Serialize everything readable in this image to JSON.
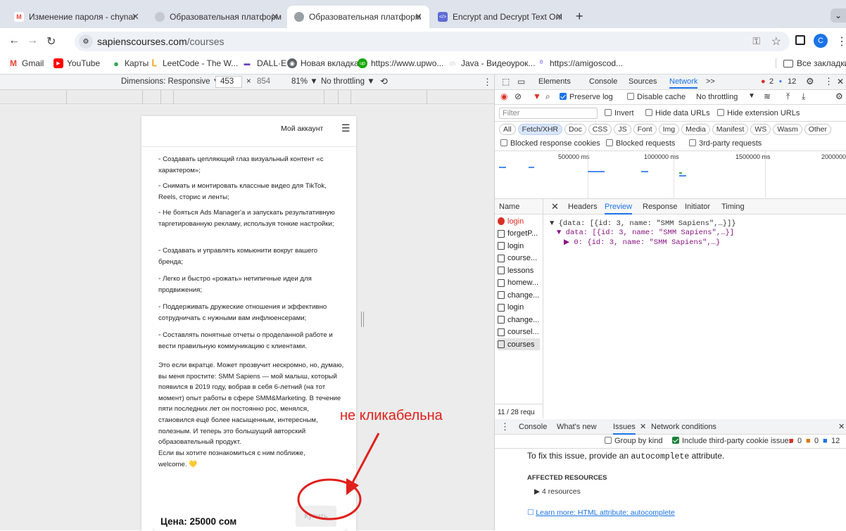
{
  "browser": {
    "tabs": [
      {
        "title": "Изменение пароля - chynar",
        "favicon": "gmail-icon",
        "favicon_color": "#EA4335"
      },
      {
        "title": "Образовательная платформ",
        "favicon": "globe-icon",
        "favicon_color": "#9aa0a6"
      },
      {
        "title": "Образовательная платформ",
        "favicon": "globe-icon",
        "favicon_color": "#9aa0a6",
        "active": true
      },
      {
        "title": "Encrypt and Decrypt Text Onl",
        "favicon": "lock-icon",
        "favicon_color": "#5f6bd6"
      }
    ],
    "new_tab": "+",
    "url_host": "sapienscourses.com",
    "url_path": "/courses",
    "profile_initial": "C",
    "bookmarks": [
      {
        "label": "Gmail",
        "icon": "gmail-icon",
        "color": "#EA4335"
      },
      {
        "label": "YouTube",
        "icon": "youtube-icon",
        "color": "#FF0000"
      },
      {
        "label": "Карты",
        "icon": "maps-icon",
        "color": "#34A853"
      },
      {
        "label": "LeetCode - The W...",
        "icon": "leetcode-icon",
        "color": "#FFA116"
      },
      {
        "label": "DALL·E",
        "icon": "dalle-icon",
        "color": "#6f42c1"
      },
      {
        "label": "Новая вкладка",
        "icon": "chrome-icon",
        "color": "#5f6368"
      },
      {
        "label": "https://www.upwo...",
        "icon": "upwork-icon",
        "color": "#14a800"
      },
      {
        "label": "Java - Видеоурок...",
        "icon": "java-icon",
        "color": "#b0b0b0"
      },
      {
        "label": "https://amigoscod...",
        "icon": "amigos-icon",
        "color": "#7b61ff"
      }
    ],
    "all_bookmarks": "Все закладки"
  },
  "device_toolbar": {
    "dimensions": "Dimensions: Responsive ▼",
    "width": "453",
    "times": "×",
    "height": "854",
    "zoom": "81% ▼",
    "throttling": "No throttling ▼"
  },
  "page": {
    "account_button": "Мой аккаунт",
    "bullets": [
      "◦ Создавать цепляющий глаз визуальный контент «с характером»;",
      "◦ Снимать и монтировать классные видео для TikTok, Reels, сторис и ленты;",
      "◦ Не бояться Ads Manager'а и запускать результативную таргетированную рекламу, используя тонкие настройки;",
      "◦ Создавать и управлять комьюнити вокруг вашего бренда;",
      "◦ Легко и быстро «рожать» нетипичные идеи для продвижения;",
      "◦ Поддерживать дружеские отношения и эффективно сотрудничать с нужными вам инфлюенсерами;",
      "◦ Составлять понятные отчеты о проделанной работе и вести правильную коммуникацию с клиентами."
    ],
    "paragraph1": "Это если вкратце. Может прозвучит нескромно, но, думаю, вы меня простите: SMM Sapiens — мой малыш, который появился в 2019 году, вобрав в себя 6-летний (на тот момент) опыт работы в сфере SMM&Marketing. В течение пяти последних лет он постоянно рос, менялся, становился ещё более насыщенным, интересным, полезным. И теперь это большущий авторский образовательный продукт.",
    "paragraph2": "Если вы хотите познакомиться с ним поближе, welcome. 💛",
    "price": "Цена: 25000 сом",
    "buy_button": "Купить"
  },
  "annotation": {
    "text": "не кликабельна",
    "color": "#e0201b"
  },
  "devtools": {
    "tabs": [
      "Elements",
      "Console",
      "Sources",
      "Network",
      ">>"
    ],
    "active_tab": "Network",
    "errors_count": "2",
    "messages_count": "12",
    "preserve_log": "Preserve log",
    "disable_cache": "Disable cache",
    "throttling": "No throttling",
    "filter_placeholder": "Filter",
    "invert": "Invert",
    "hide_data_urls": "Hide data URLs",
    "hide_extension_urls": "Hide extension URLs",
    "type_filters": [
      "All",
      "Fetch/XHR",
      "Doc",
      "CSS",
      "JS",
      "Font",
      "Img",
      "Media",
      "Manifest",
      "WS",
      "Wasm",
      "Other"
    ],
    "active_filter": "Fetch/XHR",
    "blocked_cookies": "Blocked response cookies",
    "blocked_requests": "Blocked requests",
    "third_party": "3rd-party requests",
    "timeline_labels": [
      "500000 ms",
      "1000000 ms",
      "1500000 ms",
      "2000000"
    ],
    "name_header": "Name",
    "detail_tabs": [
      "Headers",
      "Preview",
      "Response",
      "Initiator",
      "Timing"
    ],
    "active_detail_tab": "Preview",
    "requests": [
      {
        "name": "login",
        "error": true
      },
      {
        "name": "forgetP...",
        "error": false
      },
      {
        "name": "login",
        "error": false
      },
      {
        "name": "course...",
        "error": false
      },
      {
        "name": "lessons",
        "error": false
      },
      {
        "name": "homew...",
        "error": false
      },
      {
        "name": "change...",
        "error": false
      },
      {
        "name": "login",
        "error": false
      },
      {
        "name": "change...",
        "error": false
      },
      {
        "name": "coursel...",
        "error": false
      },
      {
        "name": "courses",
        "error": false,
        "selected": true
      }
    ],
    "preview_lines": [
      "▼ {data: [{id: 3, name: \"SMM Sapiens\",…}]}",
      "▼ data: [{id: 3, name: \"SMM Sapiens\",…}]",
      "▶ 0: {id: 3, name: \"SMM Sapiens\",…}"
    ],
    "request_count": "11 / 28 requ",
    "drawer_tabs": [
      "Console",
      "What's new",
      "Issues",
      "Network conditions"
    ],
    "active_drawer_tab": "Issues",
    "group_by_kind": "Group by kind",
    "include_third_party": "Include third-party cookie issues",
    "issue_counts": [
      "0",
      "0",
      "12"
    ],
    "issue_text_prefix": "To fix this issue, provide an ",
    "issue_code": "autocomplete",
    "issue_text_suffix": " attribute.",
    "affected_resources": "AFFECTED RESOURCES",
    "resources": "▶ 4 resources",
    "learn_more": "Learn more: HTML attribute: autocomplete"
  }
}
